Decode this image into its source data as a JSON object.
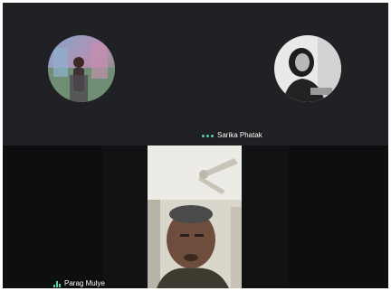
{
  "participants": {
    "top_left": {
      "name": ""
    },
    "top_right": {
      "name": "Sarika Phatak"
    },
    "active_speaker": {
      "name": "Parag Mulye"
    }
  },
  "colors": {
    "background": "#202124",
    "accent": "#54d1a6"
  },
  "icons": {
    "top_right_indicator": "audio-dots-icon",
    "speaker_indicator": "mic-activity-icon"
  }
}
